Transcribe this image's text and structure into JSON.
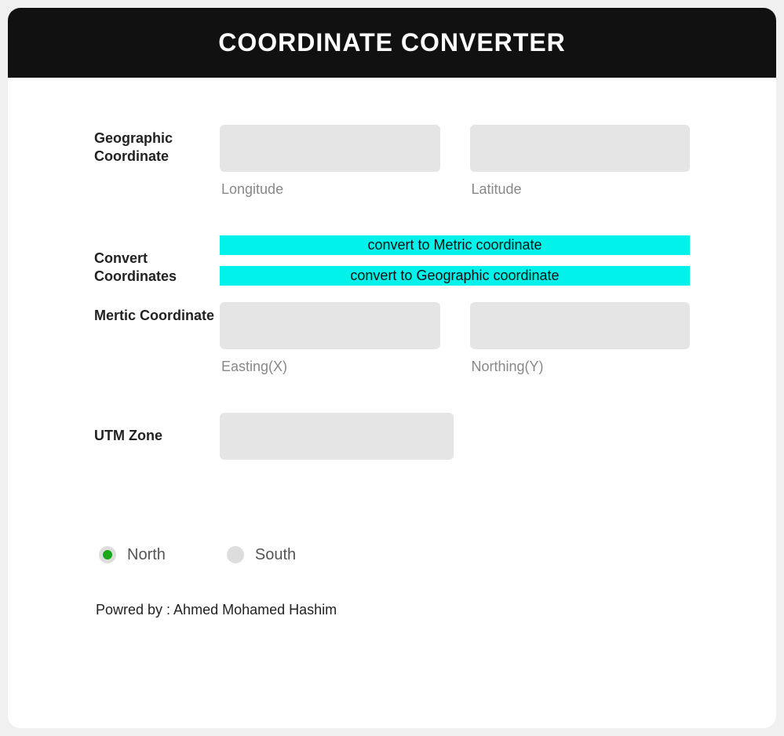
{
  "header": {
    "title": "COORDINATE CONVERTER"
  },
  "geo": {
    "label": "Geographic Coordinate",
    "longitude": {
      "value": "",
      "sub": "Longitude"
    },
    "latitude": {
      "value": "",
      "sub": "Latitude"
    }
  },
  "convert": {
    "label": "Convert Coordinates",
    "to_metric": "convert to Metric coordinate",
    "to_geographic": "convert to Geographic coordinate"
  },
  "metric": {
    "label": "Mertic Coordinate",
    "easting": {
      "value": "",
      "sub": "Easting(X)"
    },
    "northing": {
      "value": "",
      "sub": "Northing(Y)"
    }
  },
  "utm": {
    "label": "UTM Zone",
    "value": ""
  },
  "hemisphere": {
    "north": "North",
    "south": "South",
    "selected": "north"
  },
  "footer": {
    "powered": "Powred by : Ahmed Mohamed Hashim"
  }
}
